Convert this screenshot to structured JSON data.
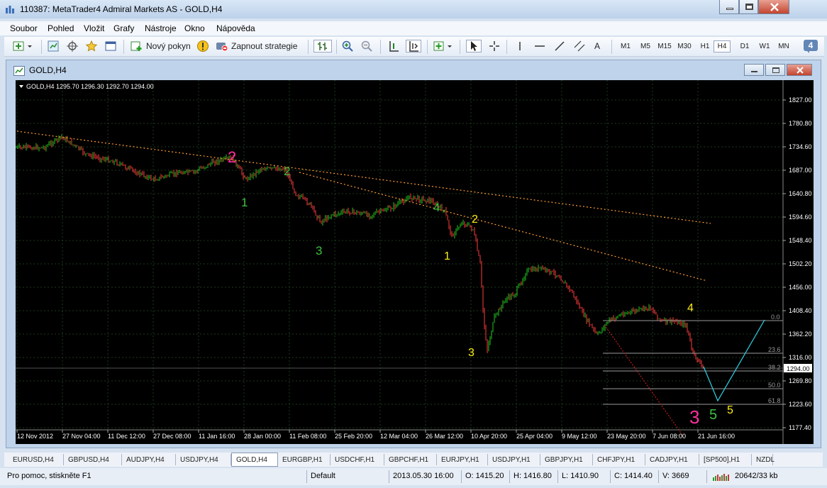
{
  "window": {
    "title": "110387: MetaTrader4 Admiral Markets AS - GOLD,H4"
  },
  "menu": [
    "Soubor",
    "Pohled",
    "Vložit",
    "Grafy",
    "Nástroje",
    "Okno",
    "Nápověda"
  ],
  "toolbar": {
    "new_order_label": "Nový pokyn",
    "autotrading_label": "Zapnout strategie",
    "text_tool_label": "A",
    "timeframes": [
      "M1",
      "M5",
      "M15",
      "M30",
      "H1",
      "H4",
      "D1",
      "W1",
      "MN"
    ],
    "active_timeframe": "H4",
    "notification_count": "4"
  },
  "chart": {
    "window_title": "GOLD,H4",
    "info_line": "GOLD,H4  1295.70 1296.30 1292.70 1294.00",
    "current_price": "1294.00",
    "price_labels": [
      "1827.00",
      "1780.80",
      "1734.60",
      "1687.00",
      "1640.80",
      "1594.60",
      "1548.40",
      "1502.20",
      "1456.00",
      "1408.40",
      "1362.20",
      "1316.00",
      "1269.80",
      "1223.60",
      "1177.40"
    ],
    "time_labels": [
      "12 Nov 2012",
      "27 Nov 04:00",
      "11 Dec 12:00",
      "27 Dec 08:00",
      "11 Jan 16:00",
      "28 Jan 00:00",
      "11 Feb 08:00",
      "25 Feb 20:00",
      "12 Mar 04:00",
      "26 Mar 12:00",
      "10 Apr 20:00",
      "25 Apr 04:00",
      "9 May 12:00",
      "23 May 20:00",
      "7 Jun 08:00",
      "21 Jun 16:00"
    ],
    "fib_levels": [
      "0.0",
      "23.6",
      "38.2",
      "50.0",
      "61.8"
    ],
    "wave_labels": [
      "2",
      "2",
      "1",
      "3",
      "4",
      "2",
      "1",
      "3",
      "4",
      "3",
      "5",
      "5"
    ],
    "colors": {
      "background": "#000000",
      "grid": "#1f3d1f",
      "bull": "#22c81e",
      "bear": "#ff3b3b",
      "trendline": "#ff9c32",
      "fib": "#9a9a9a",
      "projection": "#2fd4e6",
      "wave_pink": "#ff2fa0",
      "wave_green": "#3fbf3f",
      "wave_yellow": "#ffee11"
    }
  },
  "tabs": [
    "EURUSD,H4",
    "GBPUSD,H4",
    "AUDJPY,H4",
    "USDJPY,H4",
    "GOLD,H4",
    "EURGBP,H1",
    "USDCHF,H1",
    "GBPCHF,H1",
    "EURJPY,H1",
    "USDJPY,H1",
    "GBPJPY,H1",
    "CHFJPY,H1",
    "CADJPY,H1",
    "[SP500],H1",
    "NZDL"
  ],
  "active_tab": "GOLD,H4",
  "status": {
    "help": "Pro pomoc, stiskněte F1",
    "profile": "Default",
    "datetime": "2013.05.30 16:00",
    "open": "O: 1415.20",
    "high": "H: 1416.80",
    "low": "L: 1410.90",
    "close": "C: 1414.40",
    "volume": "V: 3669",
    "traffic": "20642/33 kb"
  }
}
